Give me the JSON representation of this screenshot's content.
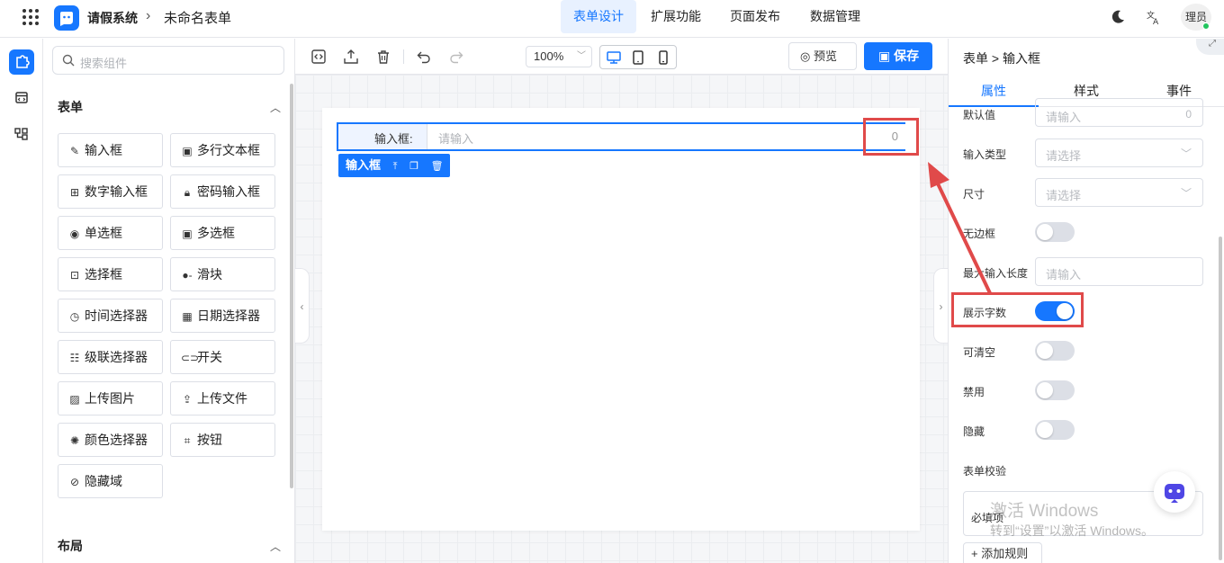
{
  "header": {
    "app_name": "请假系统",
    "form_name": "未命名表单",
    "tabs": [
      "表单设计",
      "扩展功能",
      "页面发布",
      "数据管理"
    ],
    "avatar_text": "理员"
  },
  "components": {
    "search_placeholder": "搜索组件",
    "form_section": "表单",
    "layout_section": "布局",
    "items": [
      "输入框",
      "多行文本框",
      "数字输入框",
      "密码输入框",
      "单选框",
      "多选框",
      "选择框",
      "滑块",
      "时间选择器",
      "日期选择器",
      "级联选择器",
      "开关",
      "上传图片",
      "上传文件",
      "颜色选择器",
      "按钮",
      "隐藏域"
    ]
  },
  "toolbar": {
    "zoom": "100%",
    "preview_label": "预览",
    "save_label": "保存"
  },
  "canvas": {
    "field_label": "输入框:",
    "field_placeholder": "请输入",
    "field_count": "0",
    "tag_label": "输入框"
  },
  "props": {
    "crumb_root": "表单",
    "crumb_sep": ">",
    "crumb_leaf": "输入框",
    "tabs": [
      "属性",
      "样式",
      "事件"
    ],
    "rows": {
      "default_label": "默认值",
      "default_placeholder": "请输入",
      "default_count": "0",
      "input_type_label": "输入类型",
      "input_type_placeholder": "请选择",
      "size_label": "尺寸",
      "size_placeholder": "请选择",
      "borderless_label": "无边框",
      "maxlen_label": "最大输入长度",
      "maxlen_placeholder": "请输入",
      "show_count_label": "展示字数",
      "clearable_label": "可清空",
      "disabled_label": "禁用",
      "hidden_label": "隐藏",
      "validation_label": "表单校验",
      "required_label": "必填项",
      "add_rule_label": "+ 添加规则"
    },
    "toggles": {
      "borderless": false,
      "show_count": true,
      "clearable": false,
      "disabled": false,
      "hidden": false
    }
  },
  "watermark": {
    "line1": "激活 Windows",
    "line2": "转到“设置”以激活 Windows。"
  },
  "colors": {
    "accent": "#1677ff",
    "highlight": "#e04a4a"
  }
}
